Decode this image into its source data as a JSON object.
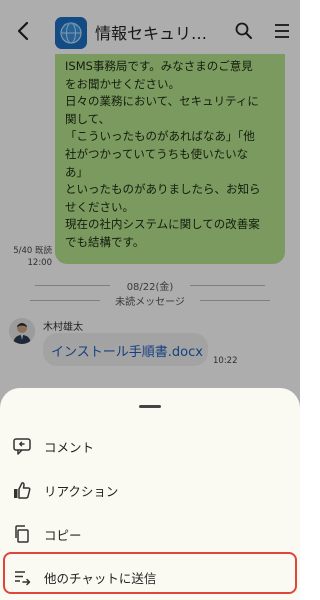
{
  "header": {
    "title": "情報セキュリ…"
  },
  "message": {
    "lines": [
      "ISMS事務局です。みなさまのご意見",
      "をお聞かせください。",
      "日々の業務において、セキュリティに",
      "関して、",
      "「こういったものがあればなあ」「他",
      "社がつかっていてうちも使いたいな",
      "あ」",
      "といったものがありましたら、お知ら",
      "せください。",
      "現在の社内システムに関しての改善案",
      "でも結構です。"
    ],
    "read_status": "5/40 既読",
    "time": "12:00"
  },
  "dividers": {
    "date": "08/22(金)",
    "unread": "未読メッセージ"
  },
  "file_message": {
    "sender": "木村雄太",
    "filename": "インストール手順書.docx",
    "time": "10:22"
  },
  "sheet": {
    "items": [
      {
        "label": "コメント",
        "icon": "comment-icon"
      },
      {
        "label": "リアクション",
        "icon": "thumbs-up-icon"
      },
      {
        "label": "コピー",
        "icon": "copy-icon"
      },
      {
        "label": "他のチャットに送信",
        "icon": "forward-icon"
      }
    ]
  },
  "colors": {
    "bubble": "#b5e48c",
    "link": "#1f5fbf",
    "highlight": "#e0453b"
  }
}
